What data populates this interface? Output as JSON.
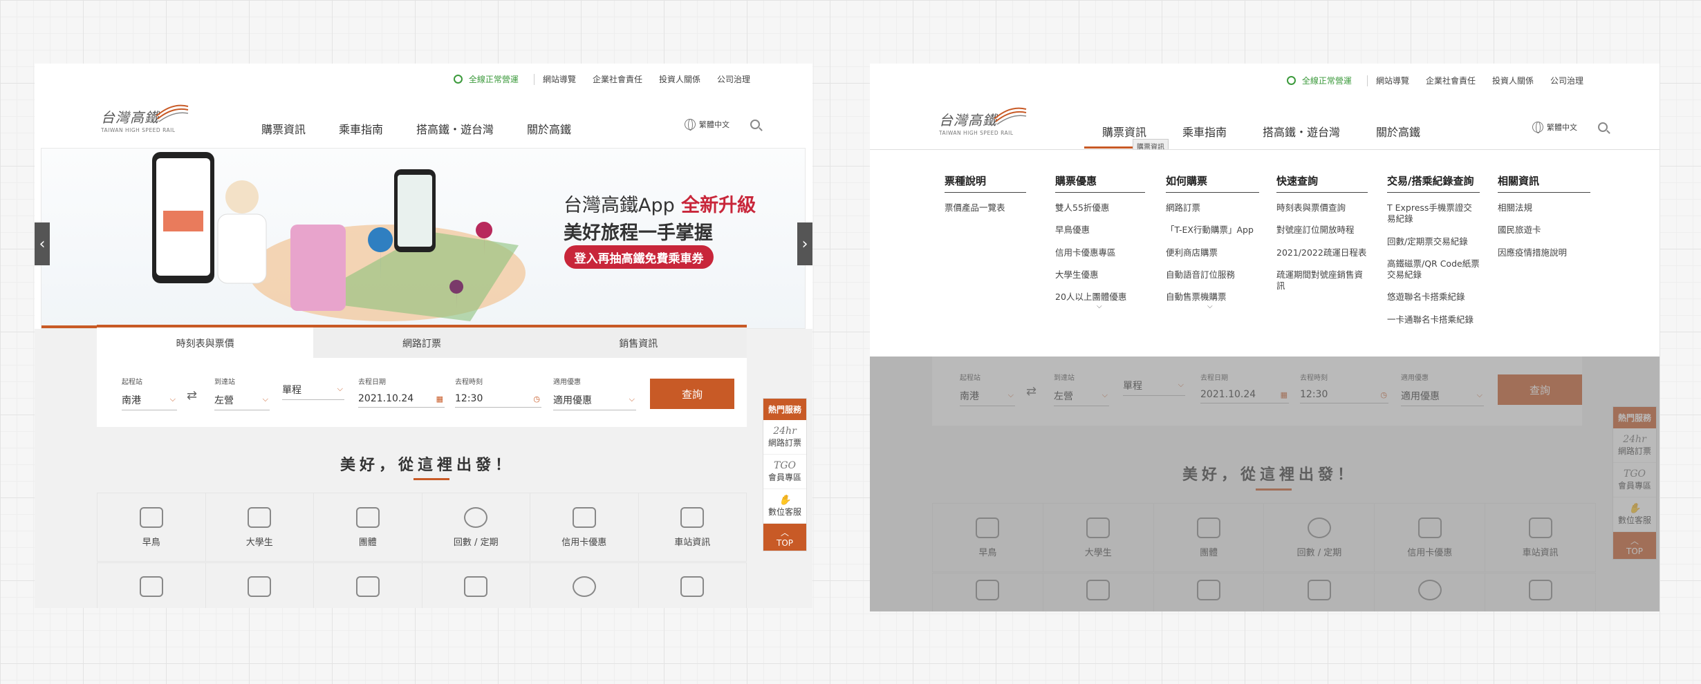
{
  "topbar": {
    "status": "全線正常營運",
    "links": [
      "網站導覽",
      "企業社會責任",
      "投資人關係",
      "公司治理"
    ]
  },
  "logo": {
    "zh": "台灣高鐵",
    "en": "TAIWAN HIGH SPEED RAIL"
  },
  "nav": [
    "購票資訊",
    "乘車指南",
    "搭高鐵・遊台灣",
    "關於高鐵"
  ],
  "language": "繁體中文",
  "banner": {
    "title_prefix": "台灣高鐵App",
    "title_highlight": "全新升級",
    "subtitle": "美好旅程一手掌握",
    "pill": "登入再抽高鐵免費乘車券"
  },
  "tabs": [
    "時刻表與票價",
    "網路訂票",
    "銷售資訊"
  ],
  "form": {
    "origin_label": "起程站",
    "origin": "南港",
    "dest_label": "到達站",
    "dest": "左營",
    "trip": "單程",
    "date_label": "去程日期",
    "date": "2021.10.24",
    "time_label": "去程時刻",
    "time": "12:30",
    "discount_label": "適用優惠",
    "discount": "適用優惠",
    "query": "查詢"
  },
  "slogan": "美好，從這裡出發！",
  "services": [
    "早鳥",
    "大學生",
    "團體",
    "回數 / 定期",
    "信用卡優惠",
    "車站資訊"
  ],
  "hot": {
    "title": "熱門服務",
    "items": [
      {
        "glyph": "24hr",
        "label": "網路訂票"
      },
      {
        "glyph": "TGO",
        "label": "會員專區"
      },
      {
        "glyph": "",
        "label": "數位客服"
      }
    ],
    "top": "TOP"
  },
  "tooltip": "購票資訊",
  "mega": [
    {
      "title": "票種說明",
      "items": [
        "票價產品一覽表"
      ]
    },
    {
      "title": "購票優惠",
      "items": [
        "雙人55折優惠",
        "早鳥優惠",
        "信用卡優惠專區",
        "大學生優惠",
        "20人以上團體優惠"
      ]
    },
    {
      "title": "如何購票",
      "items": [
        "網路訂票",
        "「T-EX行動購票」App",
        "便利商店購票",
        "自動語音訂位服務",
        "自動售票機購票"
      ]
    },
    {
      "title": "快速查詢",
      "items": [
        "時刻表與票價查詢",
        "對號座訂位開放時程",
        "2021/2022疏運日程表",
        "疏運期間對號座銷售資訊"
      ]
    },
    {
      "title": "交易/搭乘紀錄查詢",
      "items": [
        "T Express手機票證交易紀錄",
        "回數/定期票交易紀錄",
        "高鐵磁票/QR Code紙票交易紀錄",
        "悠遊聯名卡搭乘紀錄",
        "一卡通聯名卡搭乘紀錄"
      ]
    },
    {
      "title": "相關資訊",
      "items": [
        "相關法規",
        "國民旅遊卡",
        "因應疫情措施說明"
      ]
    }
  ],
  "colors": {
    "accent": "#c85a26",
    "banner_red": "#c8263a",
    "status_green": "#3c9a3c"
  }
}
